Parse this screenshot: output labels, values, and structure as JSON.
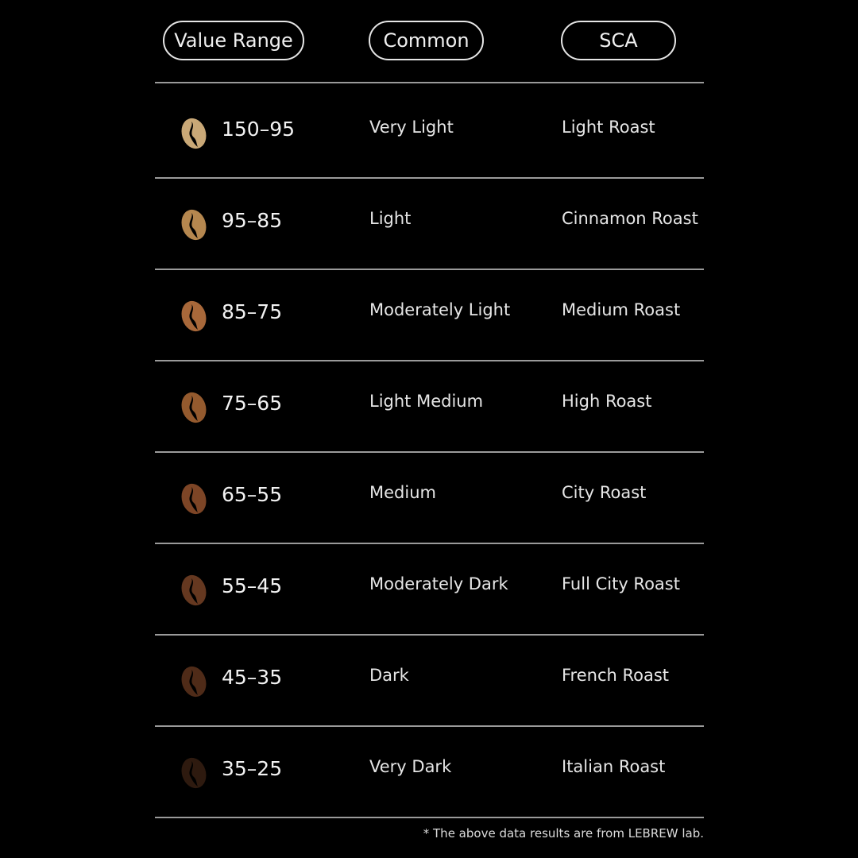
{
  "headers": {
    "value_range": "Value Range",
    "common": "Common",
    "sca": "SCA"
  },
  "rows": [
    {
      "range": "150–95",
      "common": "Very Light",
      "sca": "Light Roast",
      "bean_color": "#c9a877"
    },
    {
      "range": "95–85",
      "common": "Light",
      "sca": "Cinnamon Roast",
      "bean_color": "#b5874f"
    },
    {
      "range": "85–75",
      "common": "Moderately Light",
      "sca": "Medium Roast",
      "bean_color": "#a8683a"
    },
    {
      "range": "75–65",
      "common": "Light Medium",
      "sca": "High Roast",
      "bean_color": "#945a2e"
    },
    {
      "range": "65–55",
      "common": "Medium",
      "sca": "City Roast",
      "bean_color": "#7d4526"
    },
    {
      "range": "55–45",
      "common": "Moderately Dark",
      "sca": "Full City Roast",
      "bean_color": "#653820"
    },
    {
      "range": "45–35",
      "common": "Dark",
      "sca": "French Roast",
      "bean_color": "#4f2b18"
    },
    {
      "range": "35–25",
      "common": "Very Dark",
      "sca": "Italian Roast",
      "bean_color": "#2e1a0f"
    }
  ],
  "footnote": "* The above data results are from LEBREW lab."
}
